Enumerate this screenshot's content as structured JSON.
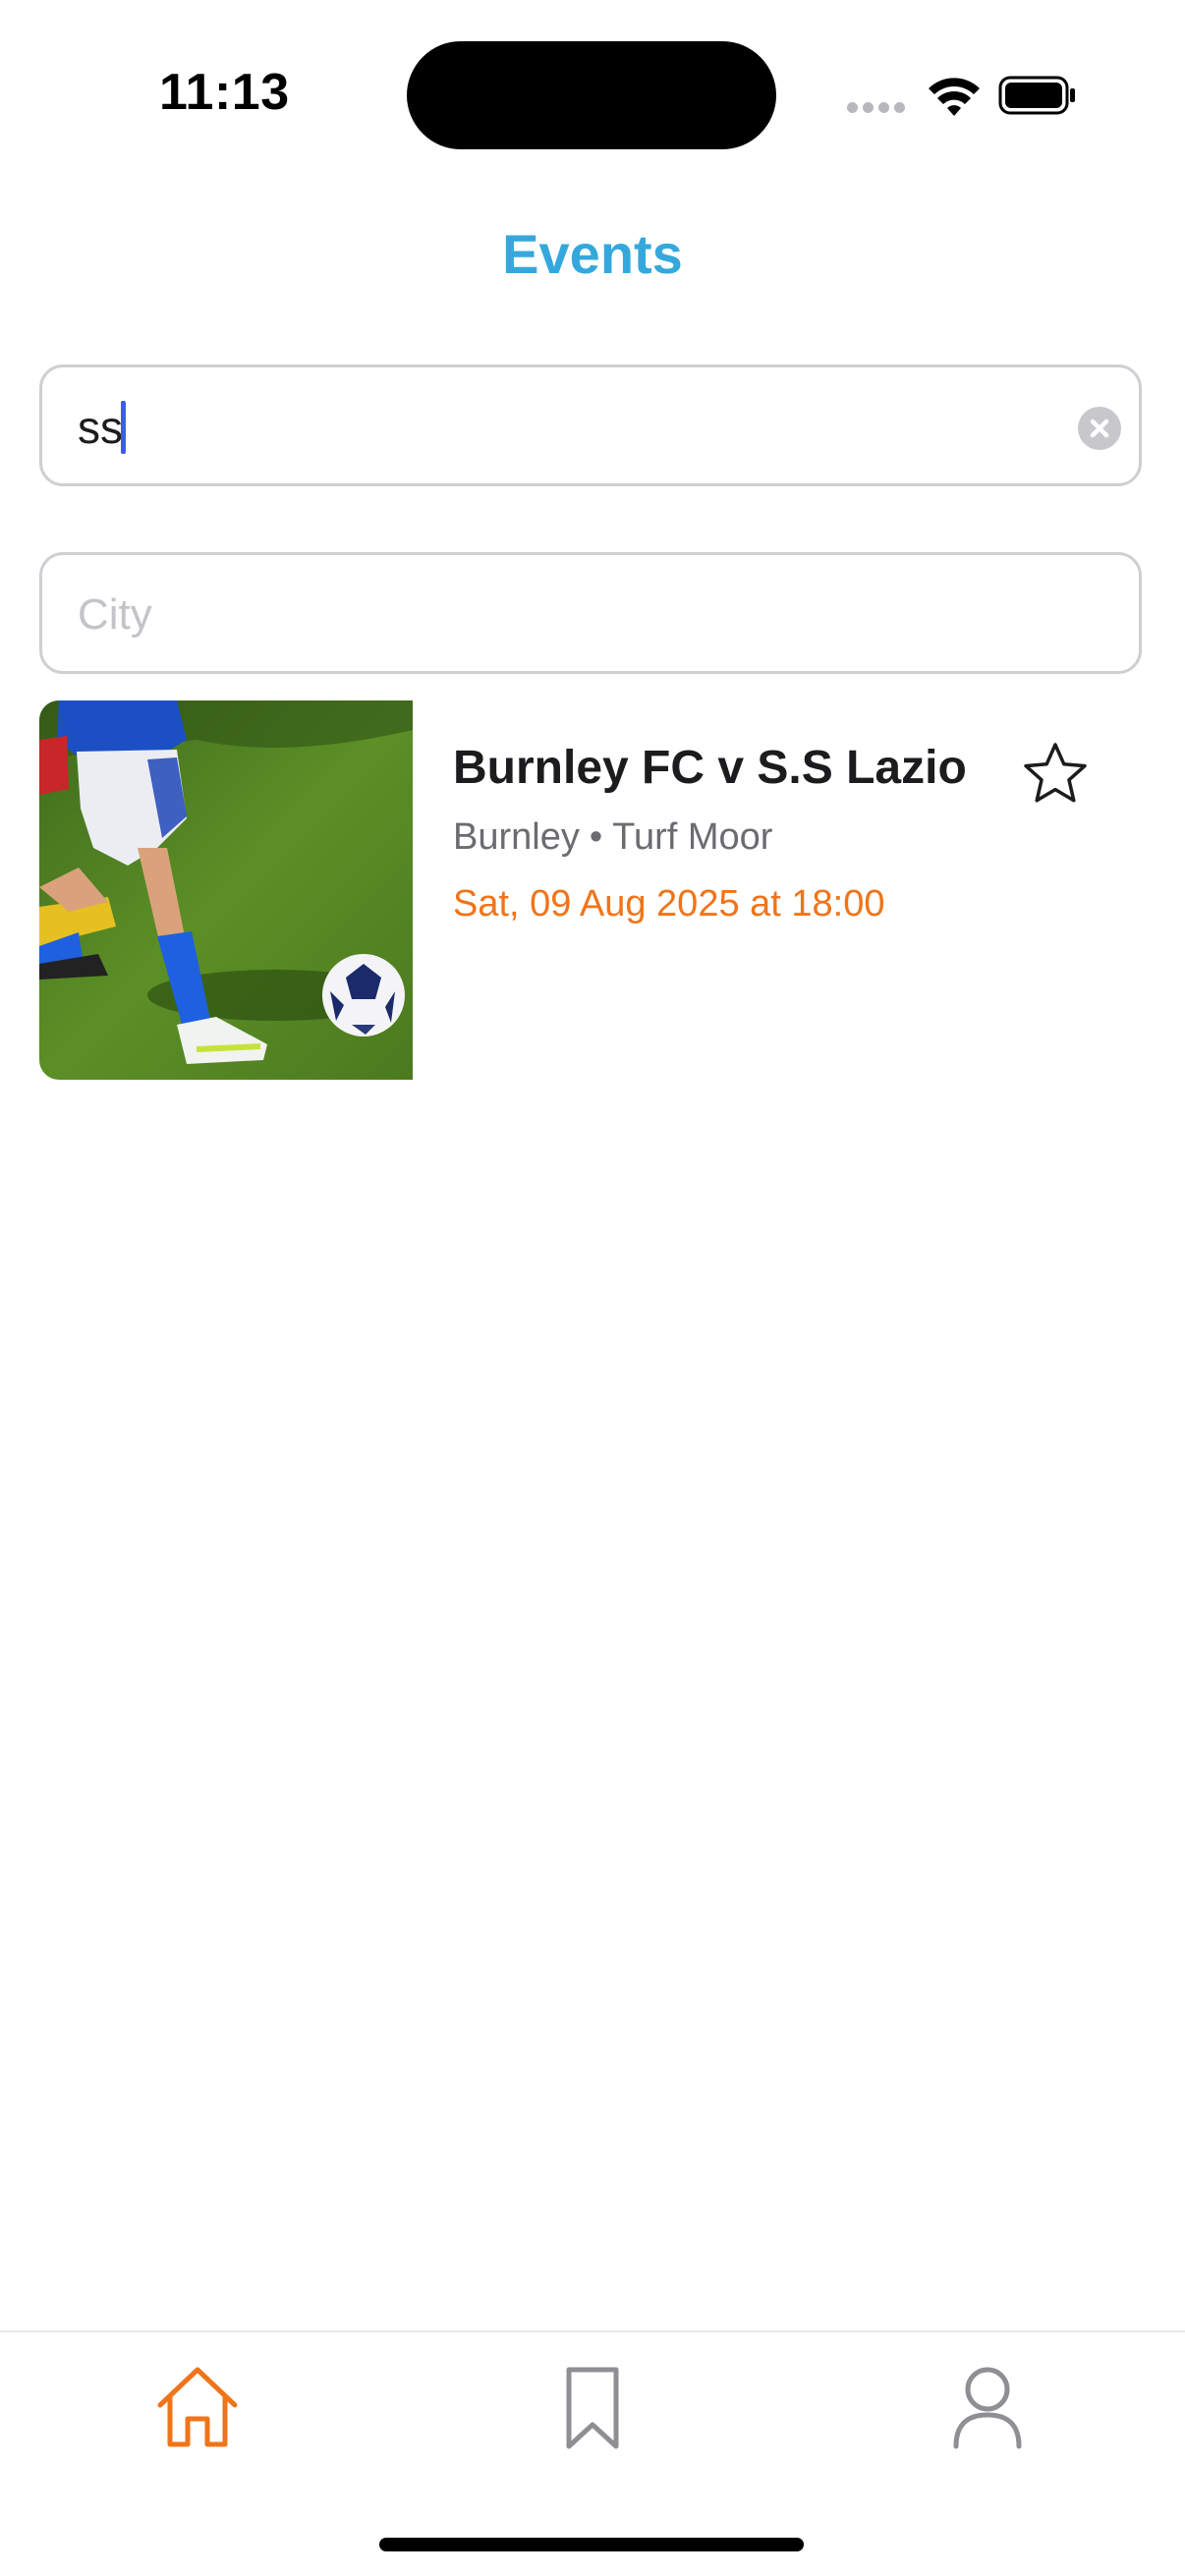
{
  "status_bar": {
    "time": "11:13"
  },
  "header": {
    "title": "Events"
  },
  "search": {
    "value": "ss",
    "clear_icon": "clear-circle-icon"
  },
  "city": {
    "placeholder": "City",
    "value": ""
  },
  "events": [
    {
      "title": "Burnley FC v S.S Lazio",
      "city": "Burnley",
      "separator": "•",
      "venue": "Turf Moor",
      "date": "Sat, 09 Aug 2025 at 18:00",
      "image": "football-player-kicking-ball",
      "favorite_icon": "star-outline-icon"
    }
  ],
  "tabs": [
    {
      "name": "home",
      "icon": "home-icon",
      "active": true
    },
    {
      "name": "saved",
      "icon": "bookmark-icon",
      "active": false
    },
    {
      "name": "profile",
      "icon": "person-icon",
      "active": false
    }
  ],
  "colors": {
    "accent_title": "#34a8dc",
    "accent_active": "#f07419",
    "date_text": "#f07419",
    "caret": "#3d5ce8"
  }
}
